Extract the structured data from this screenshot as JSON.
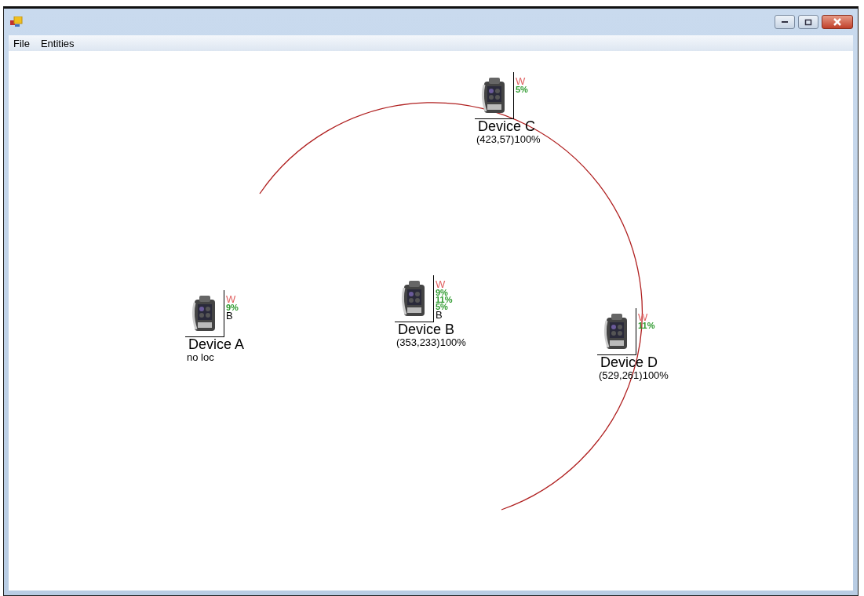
{
  "menu": [
    {
      "label": "File"
    },
    {
      "label": "Entities"
    }
  ],
  "devices": [
    {
      "name": "Device A",
      "info": "no loc",
      "tags": [
        {
          "text": "W",
          "color": "#e06060"
        },
        {
          "text": "9%",
          "color": "#2e9a2e"
        },
        {
          "text": "B",
          "color": "#000000"
        }
      ]
    },
    {
      "name": "Device B",
      "info": "(353,233)100%",
      "tags": [
        {
          "text": "W",
          "color": "#e06060"
        },
        {
          "text": "9%",
          "color": "#2e9a2e"
        },
        {
          "text": "11%",
          "color": "#2e9a2e"
        },
        {
          "text": "5%",
          "color": "#2e9a2e"
        },
        {
          "text": "B",
          "color": "#000000"
        }
      ]
    },
    {
      "name": "Device C",
      "info": "(423,57)100%",
      "tags": [
        {
          "text": "W",
          "color": "#e06060"
        },
        {
          "text": "5%",
          "color": "#2e9a2e"
        }
      ]
    },
    {
      "name": "Device D",
      "info": "(529,261)100%",
      "tags": [
        {
          "text": "W",
          "color": "#e06060"
        },
        {
          "text": "11%",
          "color": "#2e9a2e"
        }
      ]
    }
  ]
}
